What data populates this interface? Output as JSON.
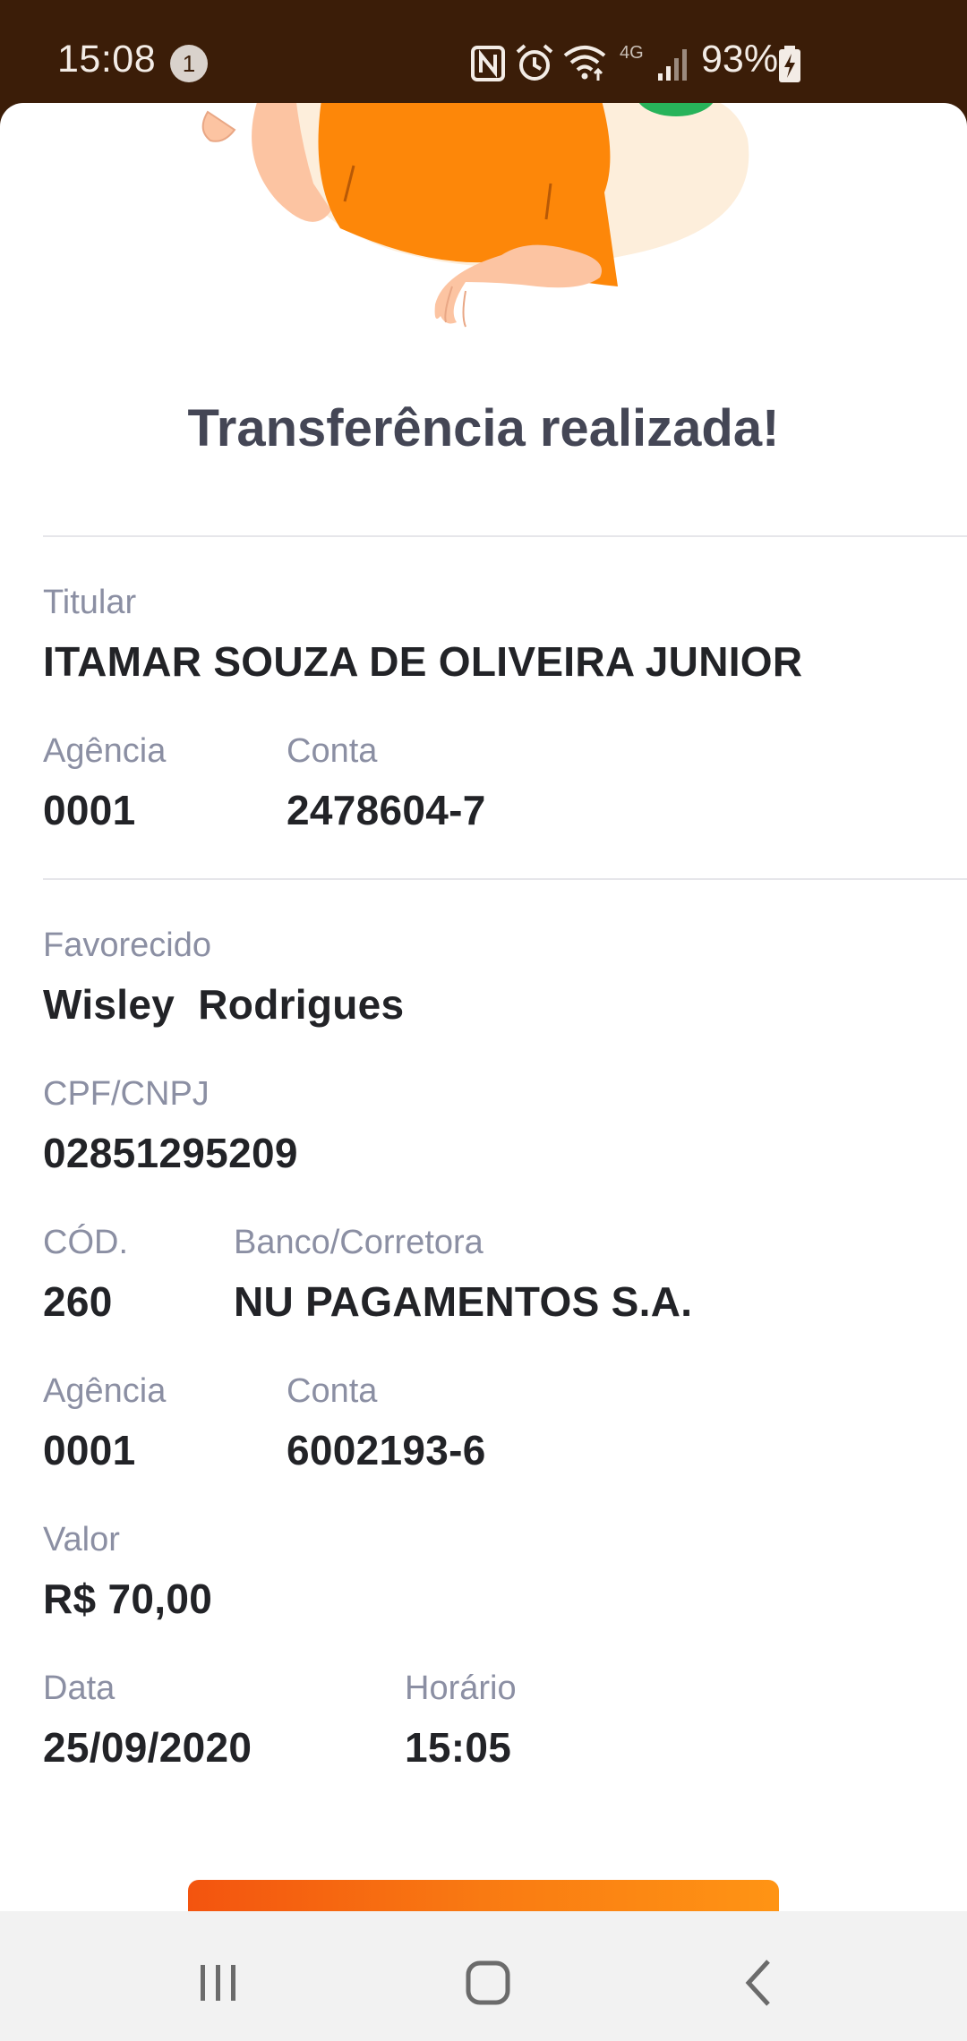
{
  "status_bar": {
    "time": "15:08",
    "notification_count": "1",
    "network_label": "4G",
    "battery": "93%",
    "icons": [
      "nfc-icon",
      "alarm-icon",
      "wifi-icon",
      "signal-icon",
      "battery-charging-icon"
    ]
  },
  "receipt": {
    "title": "Transferência realizada!",
    "sender": {
      "holder_label": "Titular",
      "holder_name": "ITAMAR SOUZA DE OLIVEIRA JUNIOR",
      "agency_label": "Agência",
      "agency": "0001",
      "account_label": "Conta",
      "account": "2478604-7"
    },
    "recipient": {
      "name_label": "Favorecido",
      "name": "Wisley  Rodrigues",
      "doc_label": "CPF/CNPJ",
      "doc": "02851295209",
      "bank_code_label": "CÓD.",
      "bank_code": "260",
      "bank_label": "Banco/Corretora",
      "bank": "NU PAGAMENTOS S.A.",
      "agency_label": "Agência",
      "agency": "0001",
      "account_label": "Conta",
      "account": "6002193-6",
      "amount_label": "Valor",
      "amount": "R$ 70,00",
      "date_label": "Data",
      "date": "25/09/2020",
      "time_label": "Horário",
      "time": "15:05"
    }
  },
  "colors": {
    "status_bar": "#3b1d08",
    "accent_orange": "#f97a12",
    "label_gray": "#8b8fa3",
    "value_dark": "#222327",
    "title": "#444655"
  },
  "navigation": {
    "icons": [
      "recent-apps-icon",
      "home-icon",
      "back-icon"
    ]
  }
}
